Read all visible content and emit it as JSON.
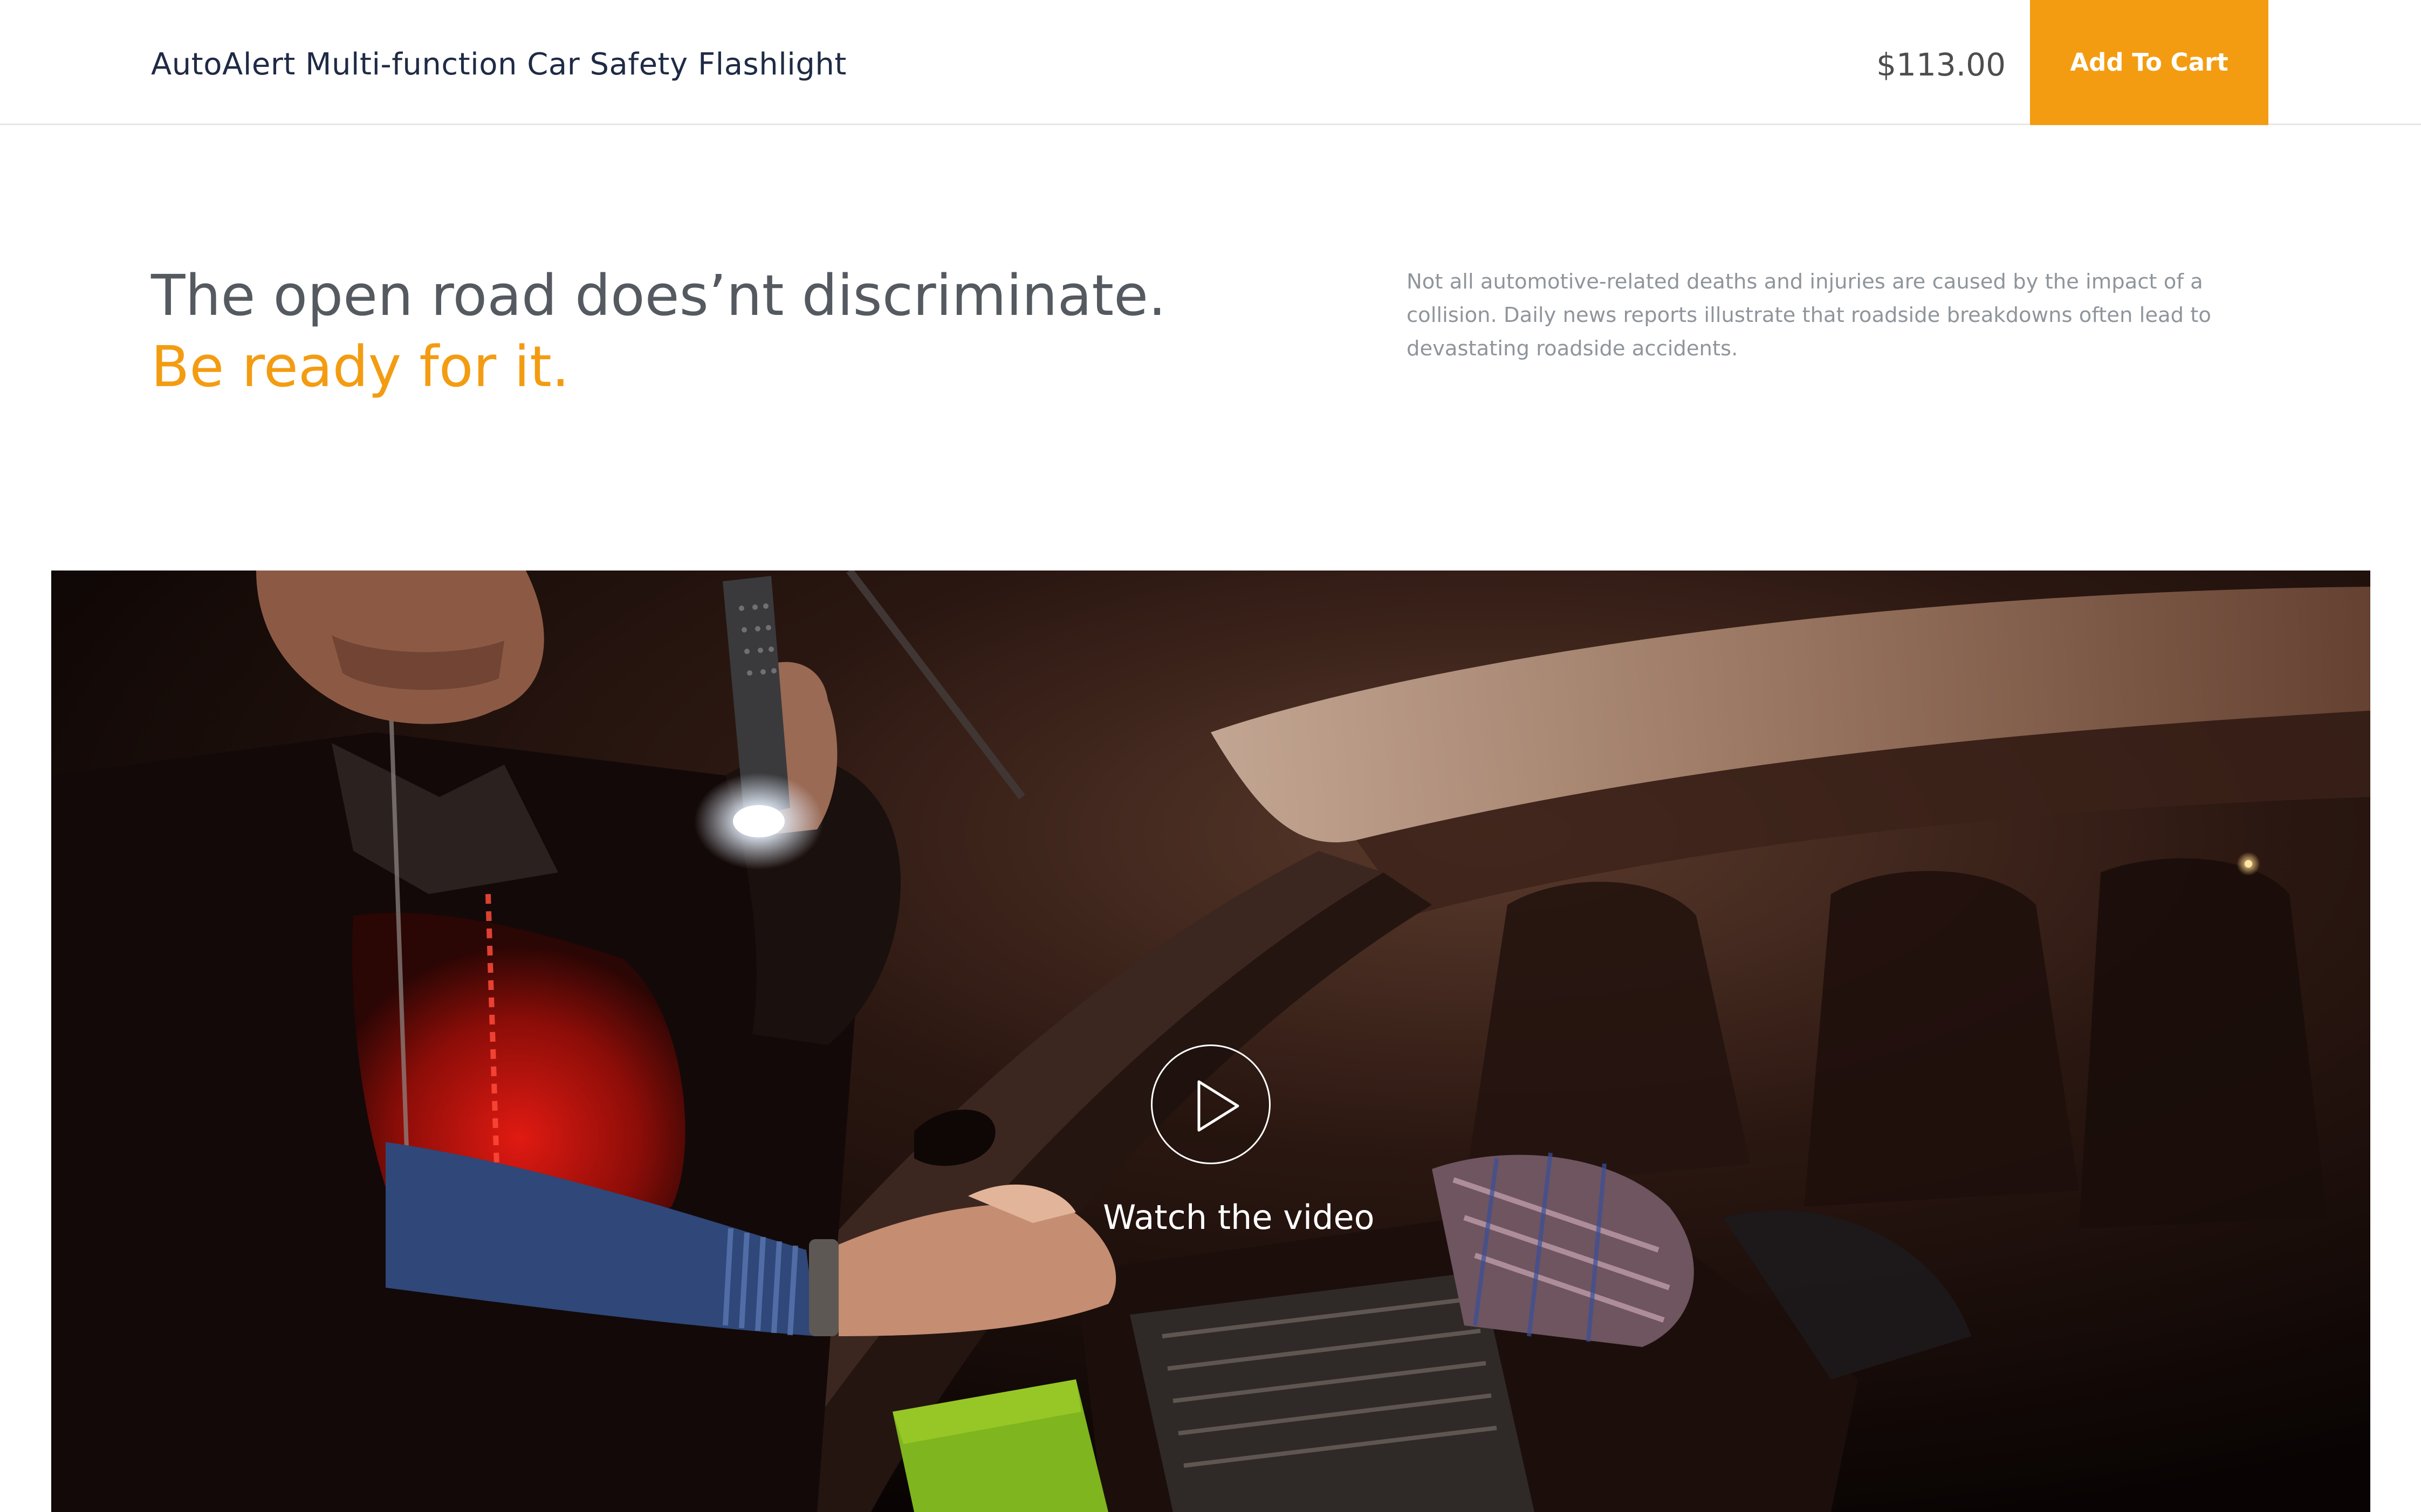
{
  "header": {
    "product_name": "AutoAlert Multi-function Car Safety Flashlight",
    "price": "$113.00",
    "cart_button_label": "Add To Cart"
  },
  "intro": {
    "headline": "The open road does’nt discriminate.",
    "tagline": "Be ready for it.",
    "description": "Not all automotive-related deaths and injuries are caused by the impact of a collision. Daily news reports illustrate that roadside breakdowns often lead to devastating roadside accidents."
  },
  "video": {
    "cta_label": "Watch the video",
    "play_icon": "play-icon"
  },
  "colors": {
    "accent": "#f39c12",
    "title": "#1f2b45",
    "headline": "#555a60",
    "body_text": "#8f959b",
    "price": "#4d4d4d"
  }
}
